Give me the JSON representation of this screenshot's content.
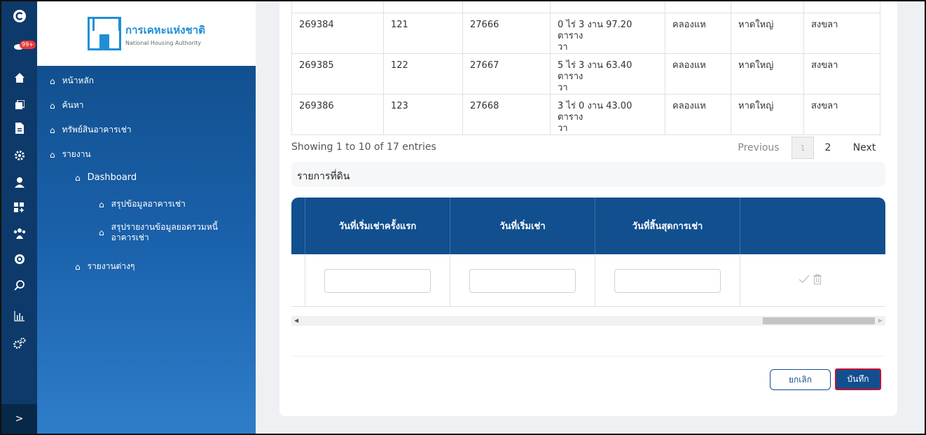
{
  "colors": {
    "rail": "#0d3a6a",
    "primary": "#114f8f",
    "highlight": "#c8102e",
    "notify": "#e53b3b"
  },
  "rail": {
    "notification_count": "99+",
    "icons": [
      "logo-c-icon",
      "bell-icon",
      "home-icon",
      "copy-icon",
      "file-icon",
      "gear-icon",
      "user-icon",
      "grid-plus-icon",
      "users-icon",
      "settings-icon",
      "search-icon",
      "bar-chart-icon",
      "cogs-icon"
    ],
    "toggle": ">"
  },
  "logo": {
    "name_th": "การเคหะแห่งชาติ",
    "name_en": "National Housing Authority"
  },
  "sidebar": {
    "items": [
      {
        "label": "หน้าหลัก"
      },
      {
        "label": "ค้นหา"
      },
      {
        "label": "ทรัพย์สินอาคารเช่า"
      },
      {
        "label": "รายงาน"
      },
      {
        "label": "Dashboard"
      },
      {
        "label": "สรุปข้อมูลอาคารเช่า"
      },
      {
        "label": "สรุปรายงานข้อมูลยอดรวมหนี้"
      },
      {
        "label": "อาคารเช่า"
      },
      {
        "label": "รายงานต่างๆ"
      }
    ]
  },
  "land_table": {
    "rows": [
      [
        "269384",
        "121",
        "27666",
        "0 ไร่ 3 งาน 97.20 ตาราง",
        "วา",
        "คลองแห",
        "หาดใหญ่",
        "สงขลา"
      ],
      [
        "269385",
        "122",
        "27667",
        "5 ไร่ 3 งาน 63.40 ตาราง",
        "วา",
        "คลองแห",
        "หาดใหญ่",
        "สงขลา"
      ],
      [
        "269386",
        "123",
        "27668",
        "3 ไร่ 0 งาน 43.00 ตาราง",
        "วา",
        "คลองแห",
        "หาดใหญ่",
        "สงขลา"
      ]
    ]
  },
  "pagination": {
    "summary": "Showing 1 to 10 of 17 entries",
    "previous": "Previous",
    "page1": "1",
    "page2": "2",
    "next": "Next"
  },
  "section": {
    "title": "รายการที่ดิน"
  },
  "lease_table": {
    "headers": [
      "วันที่เริ่มเช่าครั้งแรก",
      "วันที่เริ่มเช่า",
      "วันที่สิ้นสุดการเช่า"
    ],
    "inputs": [
      "",
      "",
      ""
    ]
  },
  "actions": {
    "cancel": "ยกเลิก",
    "save": "บันทึก"
  }
}
